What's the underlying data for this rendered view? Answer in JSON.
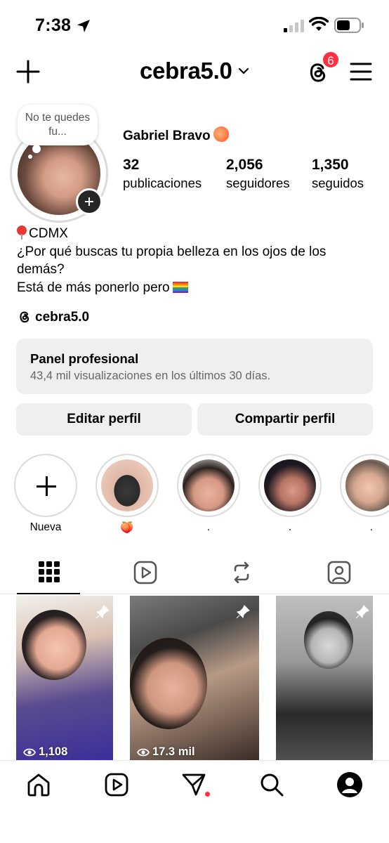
{
  "status_bar": {
    "time": "7:38"
  },
  "header": {
    "username": "cebra5.0",
    "notification_count": "6"
  },
  "profile": {
    "note": "No te quedes fu...",
    "display_name": "Gabriel Bravo",
    "stats": {
      "posts_count": "32",
      "posts_label": "publicaciones",
      "followers_count": "2,056",
      "followers_label": "seguidores",
      "following_count": "1,350",
      "following_label": "seguidos"
    },
    "bio": {
      "line1": "CDMX",
      "line2": "¿Por qué buscas tu propia belleza en los ojos de los demás?",
      "line3": "Está de más ponerlo pero"
    },
    "threads_handle": "cebra5.0"
  },
  "pro_panel": {
    "title": "Panel profesional",
    "subtitle": "43,4 mil visualizaciones en los últimos 30 días."
  },
  "actions": {
    "edit_label": "Editar perfil",
    "share_label": "Compartir perfil"
  },
  "highlights": [
    {
      "label": "Nueva"
    },
    {
      "label": "🍑"
    },
    {
      "label": "."
    },
    {
      "label": "."
    },
    {
      "label": "."
    }
  ],
  "tabs": [
    "grid-icon",
    "reels-icon",
    "reposts-icon",
    "tagged-icon"
  ],
  "posts": [
    {
      "views": "1,108",
      "pinned": true
    },
    {
      "views": "17.3 mil",
      "pinned": true
    },
    {
      "views": "",
      "pinned": true
    }
  ],
  "bottom_nav": [
    "home-icon",
    "reels-icon",
    "messages-icon",
    "search-icon",
    "profile-avatar"
  ],
  "colors": {
    "badge": "#ff3040",
    "panel_bg": "#efeff1",
    "border": "#dbdbdb"
  }
}
